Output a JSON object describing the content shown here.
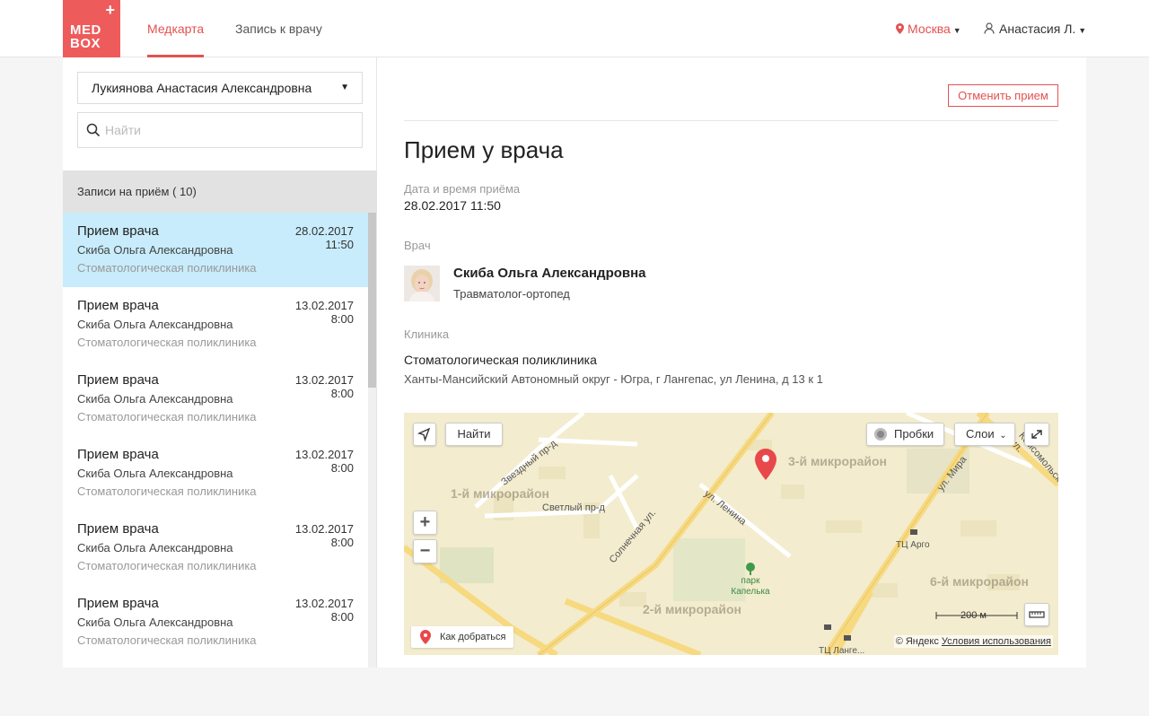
{
  "header": {
    "logo_line1": "MED",
    "logo_line2": "BOX",
    "logo_plus": "+",
    "nav": [
      {
        "label": "Медкарта",
        "active": true
      },
      {
        "label": "Запись к врачу",
        "active": false
      }
    ],
    "city": "Москва",
    "user": "Анастасия Л.",
    "accent_color": "#e35151",
    "logo_color": "#ee5b5b"
  },
  "sidebar": {
    "patient": "Лукиянова Анастасия Александровна",
    "search_placeholder": "Найти",
    "list_title": "Записи на приём ( 10)",
    "selected_color": "#c8ecfb",
    "appointments": [
      {
        "title": "Прием врача",
        "doctor": "Скиба Ольга Александровна",
        "clinic": "Стоматологическая поликлиника",
        "date": "28.02.2017",
        "time": "11:50"
      },
      {
        "title": "Прием врача",
        "doctor": "Скиба Ольга Александровна",
        "clinic": "Стоматологическая поликлиника",
        "date": "13.02.2017",
        "time": "8:00"
      },
      {
        "title": "Прием врача",
        "doctor": "Скиба Ольга Александровна",
        "clinic": "Стоматологическая поликлиника",
        "date": "13.02.2017",
        "time": "8:00"
      },
      {
        "title": "Прием врача",
        "doctor": "Скиба Ольга Александровна",
        "clinic": "Стоматологическая поликлиника",
        "date": "13.02.2017",
        "time": "8:00"
      },
      {
        "title": "Прием врача",
        "doctor": "Скиба Ольга Александровна",
        "clinic": "Стоматологическая поликлиника",
        "date": "13.02.2017",
        "time": "8:00"
      },
      {
        "title": "Прием врача",
        "doctor": "Скиба Ольга Александровна",
        "clinic": "Стоматологическая поликлиника",
        "date": "13.02.2017",
        "time": "8:00"
      }
    ]
  },
  "main": {
    "cancel_label": "Отменить прием",
    "title": "Прием у врача",
    "datetime_label": "Дата и время приёма",
    "datetime_value": "28.02.2017 11:50",
    "doctor_label": "Врач",
    "doctor_name": "Скиба Ольга Александровна",
    "doctor_specialty": "Травматолог-ортопед",
    "clinic_label": "Клиника",
    "clinic_name": "Стоматологическая поликлиника",
    "clinic_address": "Ханты-Мансийский Автономный округ - Югра, г Лангепас, ул Ленина, д 13 к 1"
  },
  "map": {
    "find_label": "Найти",
    "traffic_label": "Пробки",
    "layers_label": "Слои",
    "zoom_in": "+",
    "zoom_out": "−",
    "scale_label": "200 м",
    "route_label": "Как добраться",
    "copyright": "© Яндекс",
    "terms": "Условия использования",
    "districts": [
      "3-й микрорайон",
      "1-й микрорайон",
      "2-й микрорайон",
      "6-й микрорайон"
    ],
    "streets": [
      "Звездный пр-д",
      "Светлый пр-д",
      "ул. Ленина",
      "Солнечная ул.",
      "ул. Мира",
      "Комсомольская ул."
    ],
    "places": [
      "ТЦ Арго",
      "парк Капелька",
      "ТЦ Ланге..."
    ],
    "marker_color": "#e9484a"
  }
}
